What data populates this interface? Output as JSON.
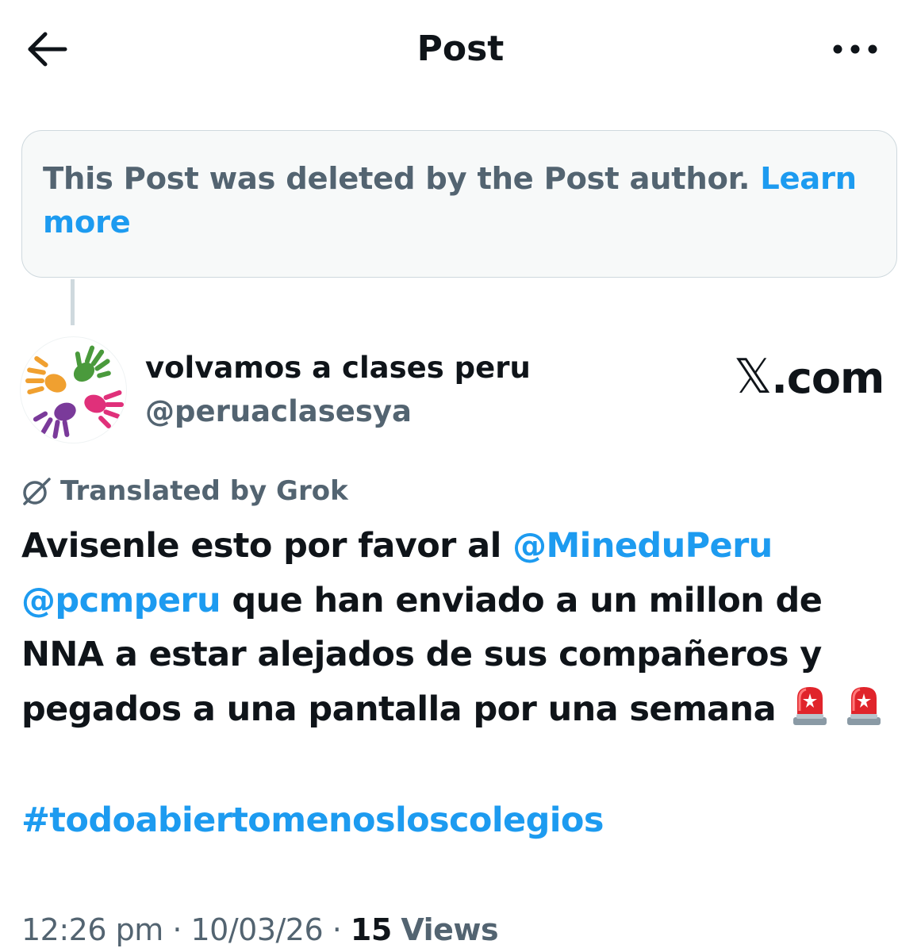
{
  "header": {
    "back_icon": "arrow-left-icon",
    "title": "Post",
    "more_icon": "more-horizontal-icon"
  },
  "deleted_notice": {
    "text": "This Post was deleted by the Post author.",
    "link_label": "Learn more"
  },
  "author": {
    "display_name": "volvamos a clases peru",
    "handle": "@peruaclasesya",
    "avatar_icon": "colorful-hands-logo"
  },
  "watermark": {
    "x_glyph": "𝕏",
    "text": ".com"
  },
  "translation": {
    "icon": "grok-icon",
    "label": "Translated by Grok"
  },
  "post": {
    "part1": "Avisenle esto por favor al ",
    "mention1": "@MineduPeru",
    "mention2": "@pcmperu",
    "part2": " que han enviado a un millon de NNA a estar alejados de sus compañeros y pegados a una pantalla por una semana",
    "emoji": "police-car-light-icon",
    "hashtag": "#todoabiertomenosloscolegios"
  },
  "meta": {
    "time": "12:26 pm",
    "separator": " · ",
    "date": "10/03/26",
    "views_count": "15",
    "views_label": "Views"
  },
  "colors": {
    "accent": "#1d9bf0",
    "secondary_text": "#536471",
    "primary_text": "#0f1419",
    "notice_bg": "#f7f9f9",
    "border": "#cfd9de"
  }
}
